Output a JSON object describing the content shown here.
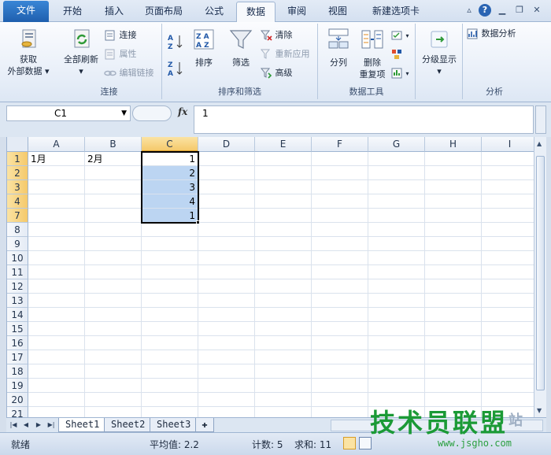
{
  "tabs": [
    "文件",
    "开始",
    "插入",
    "页面布局",
    "公式",
    "数据",
    "审阅",
    "视图",
    "新建选项卡"
  ],
  "active_tab": "数据",
  "ribbon": {
    "get_external": "获取\n外部数据",
    "get_external_line1": "获取",
    "get_external_line2": "外部数据",
    "refresh_all": "全部刷新",
    "connections": "连接",
    "properties": "属性",
    "edit_links": "编辑链接",
    "group_connect": "连接",
    "sort_label": "排序",
    "filter_label": "筛选",
    "clear_label": "清除",
    "reapply_label": "重新应用",
    "advanced_label": "高级",
    "group_sort_filter": "排序和筛选",
    "text_to_columns": "分列",
    "remove_dup_line1": "删除",
    "remove_dup_line2": "重复项",
    "group_data_tools": "数据工具",
    "outline": "分级显示",
    "group_outline": "",
    "data_analysis": "数据分析",
    "group_analysis": "分析",
    "sort_az_icon": "sort-az-icon",
    "sort_za_icon": "sort-za-icon"
  },
  "formula_bar": {
    "name_box": "C1",
    "fx": "fx",
    "value": "1"
  },
  "grid": {
    "columns": [
      "A",
      "B",
      "C",
      "D",
      "E",
      "F",
      "G",
      "H",
      "I"
    ],
    "rows": [
      "1",
      "2",
      "3",
      "4",
      "7",
      "8",
      "9",
      "10",
      "11",
      "12",
      "13",
      "14",
      "15",
      "16",
      "17",
      "18",
      "19",
      "20",
      "21"
    ],
    "cells": {
      "A1": "1月",
      "B1": "2月",
      "C1": "1",
      "C2": "2",
      "C3": "3",
      "C4": "4",
      "C7": "1"
    }
  },
  "sheets": [
    "Sheet1",
    "Sheet2",
    "Sheet3"
  ],
  "active_sheet": "Sheet1",
  "status": {
    "ready": "就绪",
    "average": "平均值: 2.2",
    "count": "计数: 5",
    "sum": "求和: 11"
  },
  "watermark": {
    "text": "技术员联盟",
    "url": "www.jsgho.com",
    "site": "站"
  },
  "colors": {
    "selection": "#bcd5f2",
    "header_selected": "#f5c96b",
    "file_tab": "#2b6fc4"
  }
}
